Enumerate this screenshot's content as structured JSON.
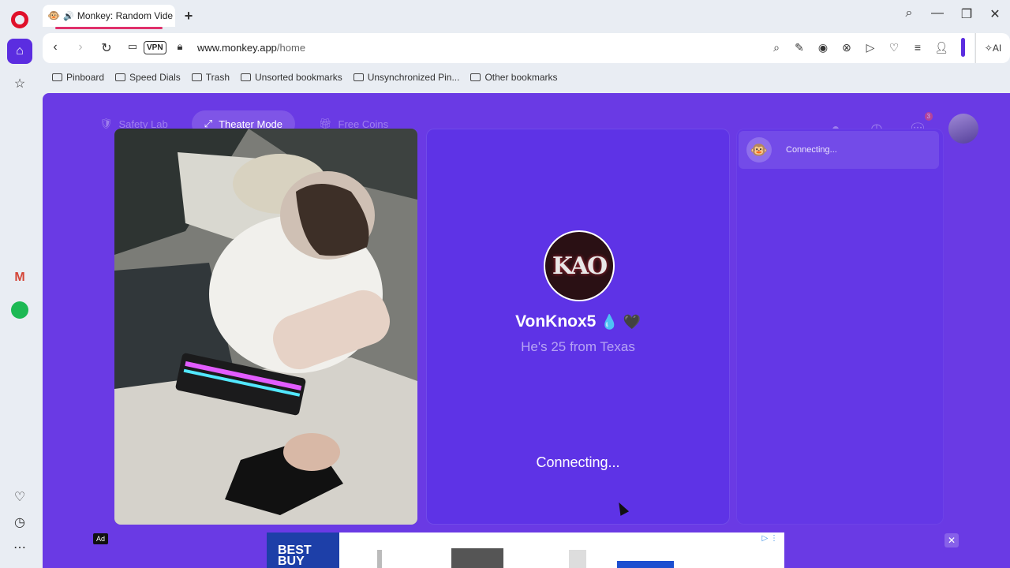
{
  "browser": {
    "tab_title": "Monkey: Random Vide",
    "tab_favicon": "🐵",
    "new_tab": "+",
    "vpn_label": "VPN",
    "url_host": "www.monkey.app",
    "url_path": "/home",
    "ai_label": "AI",
    "bookmarks": [
      "Pinboard",
      "Speed Dials",
      "Trash",
      "Unsorted bookmarks",
      "Unsynchronized Pin...",
      "Other bookmarks"
    ]
  },
  "page": {
    "nav": {
      "safety": "Safety Lab",
      "theater": "Theater Mode",
      "coins": "Free Coins"
    },
    "chat_badge": "3",
    "match": {
      "avatar_text": "KAO",
      "name": "VonKnox5",
      "drop": "💧",
      "heart": "🖤",
      "subtitle": "He's 25 from Texas",
      "status": "Connecting..."
    },
    "chat": {
      "status": "Connecting...",
      "avatar": "🐵"
    },
    "ad": {
      "label": "Ad",
      "brand_line1": "BEST",
      "brand_line2": "BUY",
      "close": "✕",
      "adchoices": "▷ ⋮"
    }
  },
  "colors": {
    "page_bg": "#6a3ae4",
    "card_bg": "#5e33e6",
    "opera_accent": "#5b2de0"
  }
}
